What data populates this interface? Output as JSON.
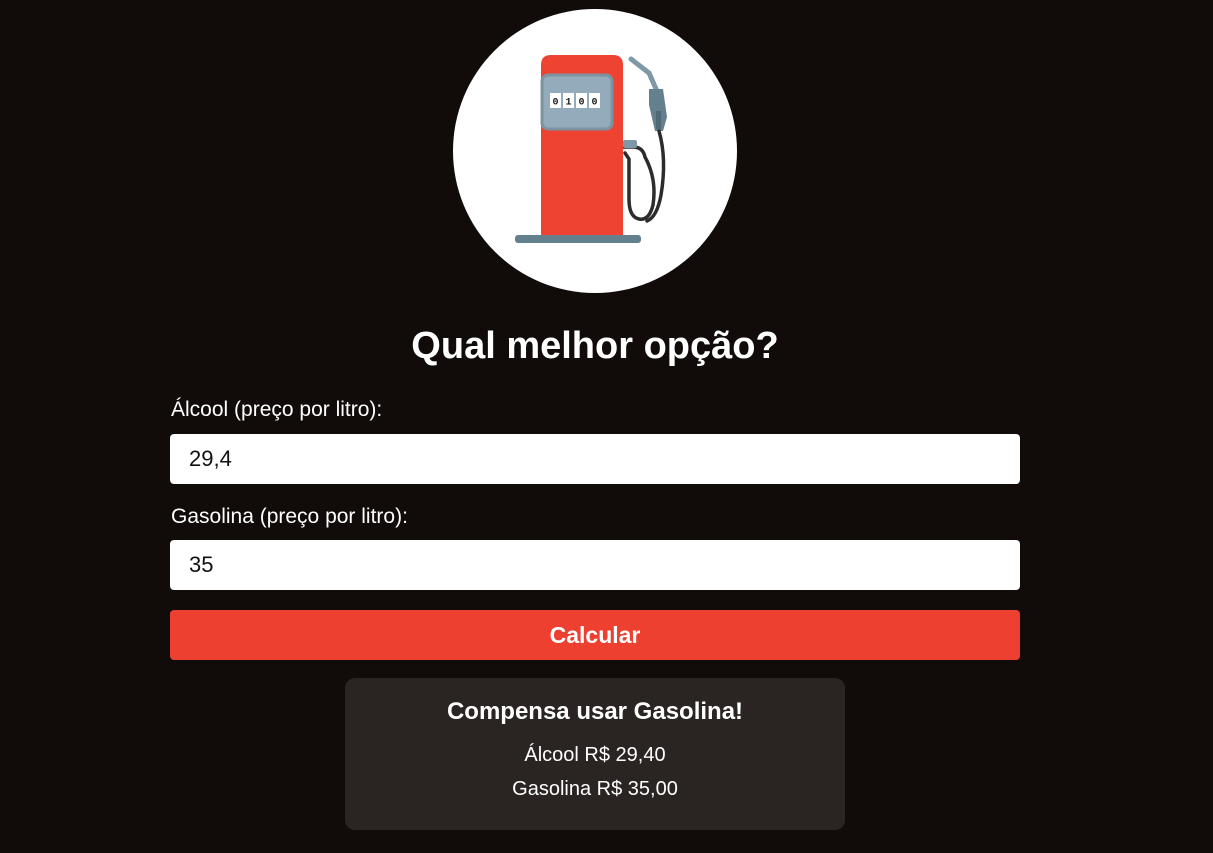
{
  "logo": {
    "icon": "fuel-pump-icon",
    "counter_digits": [
      "0",
      "1",
      "0",
      "0"
    ],
    "colors": {
      "pump_body": "#ee4232",
      "display": "#94abbb",
      "hose": "#2c2c2c",
      "nozzle": "#64808e",
      "circle": "#ffffff"
    }
  },
  "title": "Qual melhor opção?",
  "form": {
    "alcool_label": "Álcool (preço por litro):",
    "alcool_value": "29,4",
    "gasolina_label": "Gasolina (preço por litro):",
    "gasolina_value": "35",
    "submit_label": "Calcular"
  },
  "result": {
    "title": "Compensa usar Gasolina!",
    "alcool_line": "Álcool R$ 29,40",
    "gasolina_line": "Gasolina R$ 35,00"
  },
  "colors": {
    "background": "#110c0a",
    "accent": "#ed4030",
    "result_panel": "#2a2422"
  }
}
